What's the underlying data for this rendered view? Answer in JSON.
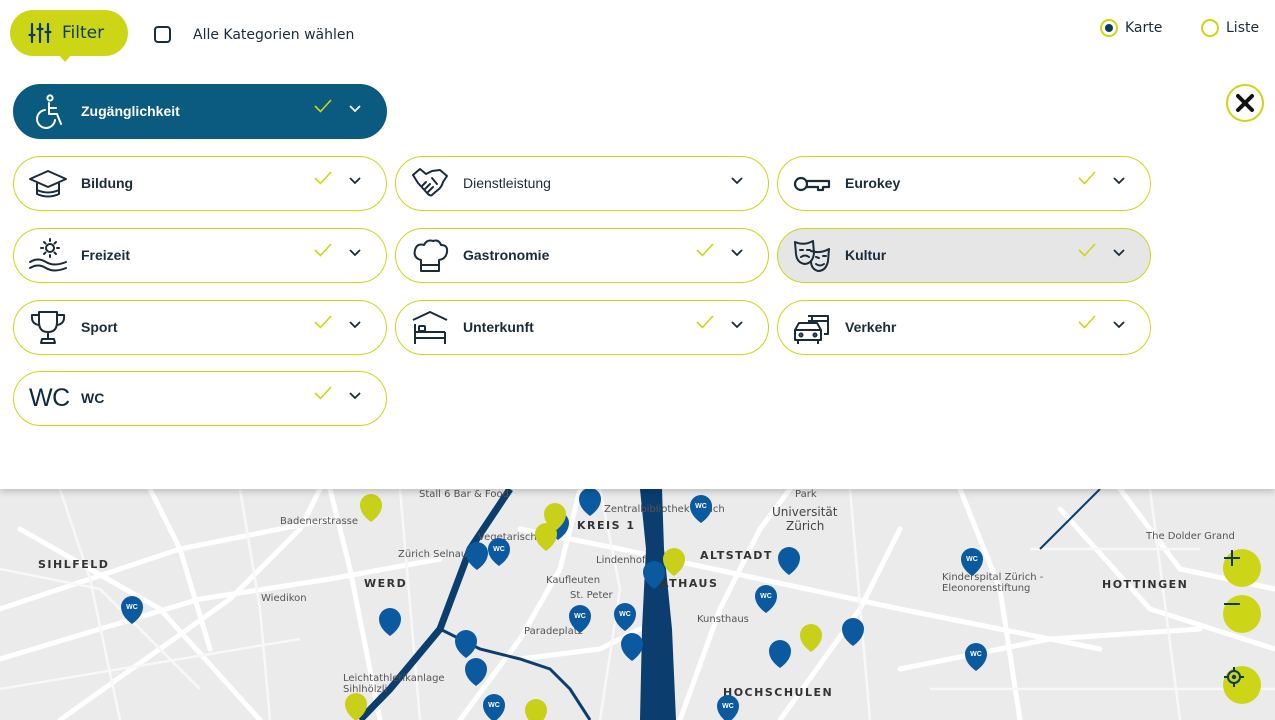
{
  "topbar": {
    "filter_label": "Filter",
    "select_all_label": "Alle Kategorien wählen",
    "view_options": [
      {
        "label": "Karte",
        "selected": true
      },
      {
        "label": "Liste",
        "selected": false
      }
    ]
  },
  "categories": [
    {
      "label": "Zugänglichkeit",
      "icon": "wheelchair-icon",
      "active": true,
      "checked": true
    },
    {
      "label": "Bildung",
      "icon": "graduation-cap-icon",
      "checked": true
    },
    {
      "label": "Dienstleistung",
      "icon": "handshake-icon",
      "checked": false
    },
    {
      "label": "Eurokey",
      "icon": "key-icon",
      "checked": true
    },
    {
      "label": "Freizeit",
      "icon": "sun-waves-icon",
      "checked": true
    },
    {
      "label": "Gastronomie",
      "icon": "chef-hat-icon",
      "checked": true
    },
    {
      "label": "Kultur",
      "icon": "theater-masks-icon",
      "checked": true,
      "highlighted": true
    },
    {
      "label": "Sport",
      "icon": "trophy-icon",
      "checked": true
    },
    {
      "label": "Unterkunft",
      "icon": "bed-icon",
      "checked": true
    },
    {
      "label": "Verkehr",
      "icon": "vehicles-icon",
      "checked": true
    },
    {
      "label": "WC",
      "icon": "wc-icon",
      "icon_text": "WC",
      "checked": true
    }
  ],
  "map": {
    "labels": {
      "sihlfeld": "SIHLFELD",
      "werd": "WERD",
      "kreis1": "KREIS 1",
      "altstadt": "ALTSTADT",
      "rathaus": "RATHAUS",
      "hottingen": "HOTTINGEN",
      "hochschulen": "HOCHSCHULEN",
      "universitaet": "Universität",
      "zuerich": "Zürich",
      "dolder": "The Dolder Grand",
      "kinderspital": "Kinderspital Zürich -",
      "eleonoren": "Eleonorenstiftung",
      "kaufleuten": "Kaufleuten",
      "stpeter": "St. Peter",
      "paradeplatz": "Paradeplatz",
      "kunsthaus": "Kunsthaus",
      "lindenhof": "Lindenhof",
      "selnau": "Zürich Selnau",
      "wiedikon": "Wiedikon",
      "stall6": "Stall 6 Bar & Food",
      "zentralbib": "Zentralbibliothek Zürich",
      "leichtathletik": "Leichtathletikanlage",
      "sihlhoelzli": "Sihlhölzli",
      "badener": "Badenerstrasse",
      "park": "Park",
      "vegetarisch": "Vegetarisches"
    },
    "pin_text": "WC"
  },
  "colors": {
    "accent": "#cdd616",
    "primary": "#0b5a80",
    "text": "#1a2b3a"
  }
}
